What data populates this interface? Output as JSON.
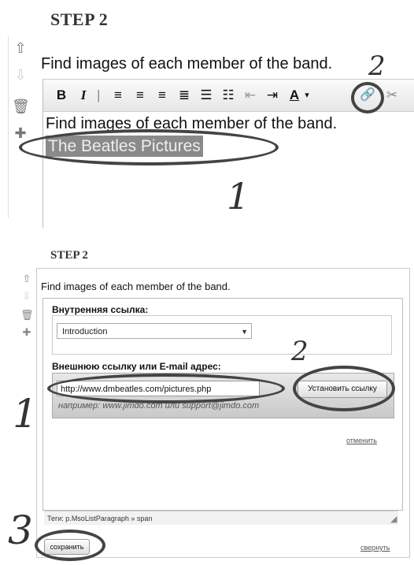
{
  "top": {
    "step_label": "STEP 2",
    "title": "Find  images of each member of the band.",
    "editor_text": "Find  images of each member of the band.",
    "selected_link_text": "The Beatles Pictures",
    "toolbar": {
      "bold": "B",
      "italic": "I",
      "font_color": "A"
    },
    "annotations": {
      "one": "1",
      "two": "2"
    }
  },
  "bottom": {
    "step_label": "STEP 2",
    "title": "Find  images of each member of the band.",
    "internal_link_label": "Внутренняя ссылка:",
    "internal_link_value": "Introduction",
    "external_link_label": "Внешнюю ссылку или E-mail адрес:",
    "external_link_value": "http://www.dmbeatles.com/pictures.php",
    "set_link_button": "Установить ссылку",
    "example_text": "например: www.jimdo.com или support@jimdo.com",
    "cancel_link": "отменить",
    "tags_bar": "Теги: p.MsoListParagraph » span",
    "save_button": "сохранить",
    "collapse_link": "свернуть",
    "annotations": {
      "one": "1",
      "two": "2",
      "three": "3"
    }
  }
}
